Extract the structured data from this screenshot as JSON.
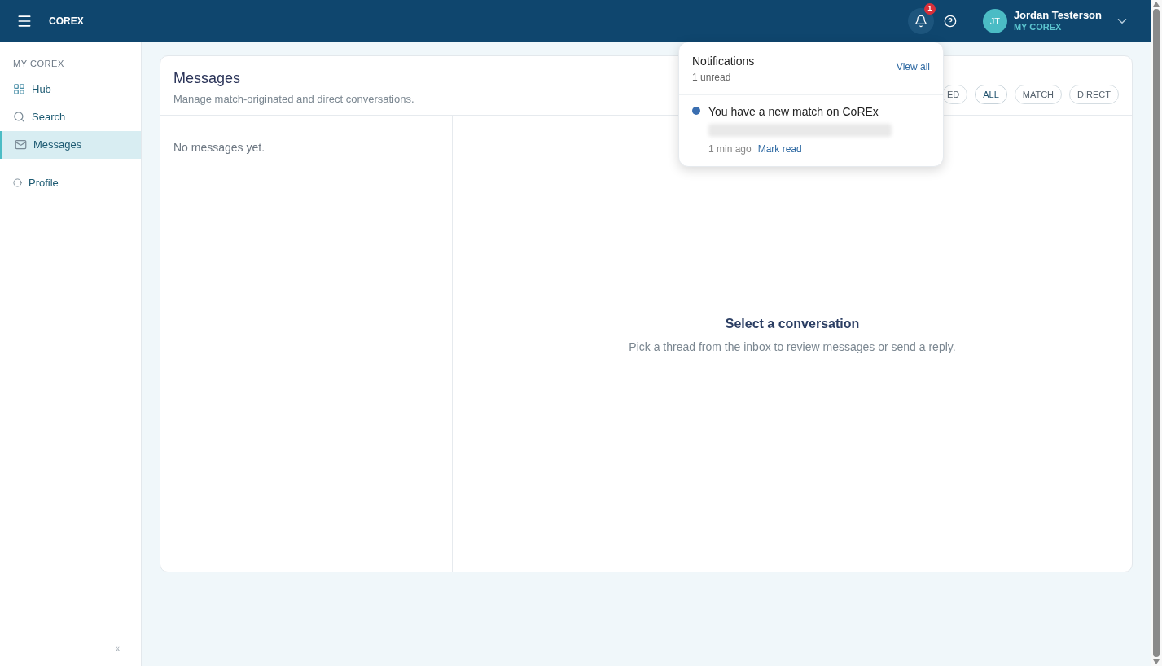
{
  "header": {
    "brand": "COREX",
    "notification_count": "1",
    "user": {
      "initials": "JT",
      "name": "Jordan Testerson",
      "subtitle": "MY COREX"
    }
  },
  "sidebar": {
    "section": "MY COREX",
    "items": [
      {
        "label": "Hub",
        "kind": "grid",
        "selected": false
      },
      {
        "label": "Search",
        "kind": "search",
        "selected": false
      },
      {
        "label": "Messages",
        "kind": "mail",
        "selected": true
      },
      {
        "label": "Profile",
        "kind": "circle",
        "selected": false
      }
    ],
    "collapse": "«"
  },
  "messages": {
    "title": "Messages",
    "subtitle": "Manage match-originated and direct conversations.",
    "filters": [
      {
        "label": "ED",
        "selected": false
      },
      {
        "label": "ALL",
        "selected": true
      },
      {
        "label": "MATCH",
        "selected": false
      },
      {
        "label": "DIRECT",
        "selected": false
      }
    ],
    "empty_list": "No messages yet.",
    "empty_title": "Select a conversation",
    "empty_text": "Pick a thread from the inbox to review messages or send a reply."
  },
  "notifications": {
    "title": "Notifications",
    "unread": "1 unread",
    "view_all": "View all",
    "items": [
      {
        "title": "You have a new match on CoREx",
        "time": "1 min ago",
        "action": "Mark read",
        "unread": true
      }
    ]
  }
}
